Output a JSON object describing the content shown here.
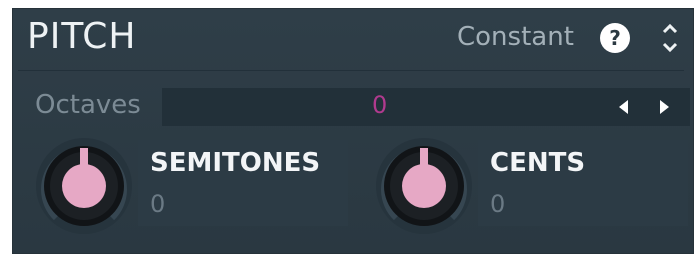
{
  "section": {
    "title": "PITCH",
    "mode": "Constant",
    "help_icon": "?"
  },
  "octaves": {
    "label": "Octaves",
    "value": "0"
  },
  "semitones": {
    "label": "SEMITONES",
    "value": "0"
  },
  "cents": {
    "label": "CENTS",
    "value": "0"
  },
  "colors": {
    "panel_bg": "#2f3e48",
    "knob_accent": "#e6a8c5",
    "value_accent": "#b03a8e"
  },
  "icons": [
    "help-icon",
    "up-down-arrows-icon",
    "arrow-left-icon",
    "arrow-right-icon"
  ]
}
